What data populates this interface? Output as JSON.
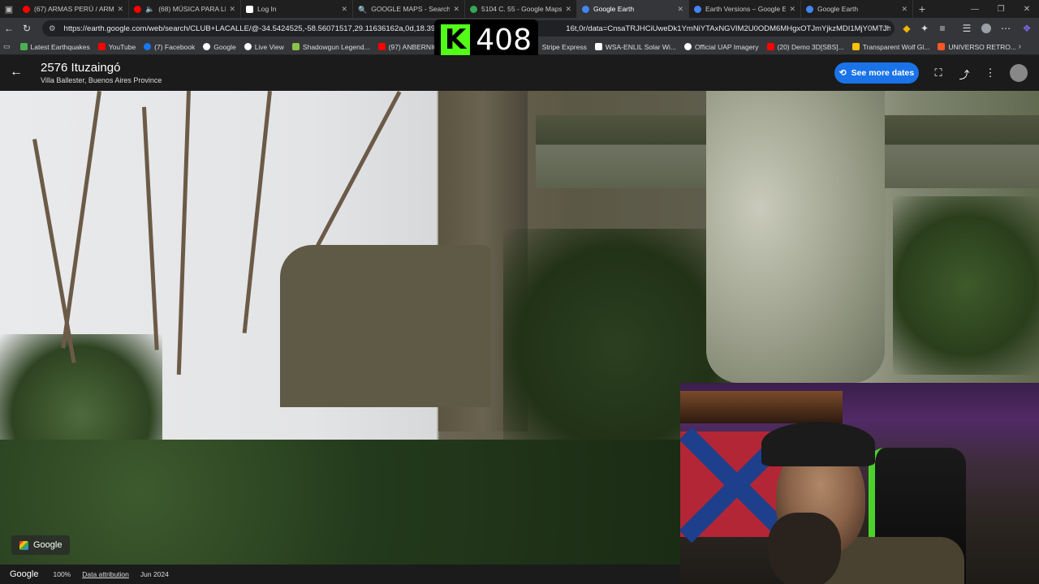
{
  "browser": {
    "tabs": [
      {
        "title": "(67) ARMAS PERÚ / ARMAS",
        "color": "#ff0000",
        "active": false
      },
      {
        "title": "(68) MÚSICA PARA LE",
        "color": "#ff0000",
        "active": false
      },
      {
        "title": "Log In",
        "color": "#ffffff",
        "active": false
      },
      {
        "title": "GOOGLE MAPS - Search",
        "color": "#4285f4",
        "active": false
      },
      {
        "title": "5104 C. 55 - Google Maps",
        "color": "#34a853",
        "active": false
      },
      {
        "title": "Google Earth",
        "color": "#4285f4",
        "active": true
      },
      {
        "title": "Earth Versions – Google Ea",
        "color": "#4285f4",
        "active": false
      },
      {
        "title": "Google Earth",
        "color": "#4285f4",
        "active": false
      }
    ],
    "url": "https://earth.google.com/web/search/CLUB+LACALLE/@-34.5424525,-58.56071517,29.11636162a,0d,18.390727",
    "url_tail": "16t,0r/data=CnsaTRJHCiUweDk1YmNiYTAxNGVIM2U0ODM6MHgxOTJmYjkzMDI1MjY0MTJhGb...",
    "bookmarks": [
      {
        "label": "Latest Earthquakes",
        "color": "#4caf50"
      },
      {
        "label": "YouTube",
        "color": "#ff0000"
      },
      {
        "label": "(7) Facebook",
        "color": "#1877f2"
      },
      {
        "label": "Google",
        "color": "#ffffff"
      },
      {
        "label": "Live View",
        "color": "#ffffff"
      },
      {
        "label": "Shadowgun Legend...",
        "color": "#8bc34a"
      },
      {
        "label": "(97) ANBERNIC",
        "color": "#ff0000"
      },
      {
        "label": "Stripe Express",
        "color": "#635bff"
      },
      {
        "label": "WSA-ENLIL Solar Wi...",
        "color": "#ffffff"
      },
      {
        "label": "Official UAP Imagery",
        "color": "#ffffff"
      },
      {
        "label": "(20) Demo 3D[SBS]...",
        "color": "#ff0000"
      },
      {
        "label": "Transparent Wolf Gl...",
        "color": "#ffc107"
      },
      {
        "label": "UNIVERSO RETRO...",
        "color": "#ff5722"
      }
    ]
  },
  "overlay": {
    "kick_letter": "K",
    "viewer_count": "408"
  },
  "earth": {
    "place_title": "2576 Ituzaingó",
    "place_subtitle": "Villa Ballester, Buenos Aires Province",
    "see_more_dates": "See more dates",
    "badge_label": "Google",
    "footer": {
      "logo": "Google",
      "zoom": "100%",
      "data_attribution": "Data attribution",
      "date": "Jun 2024"
    }
  }
}
